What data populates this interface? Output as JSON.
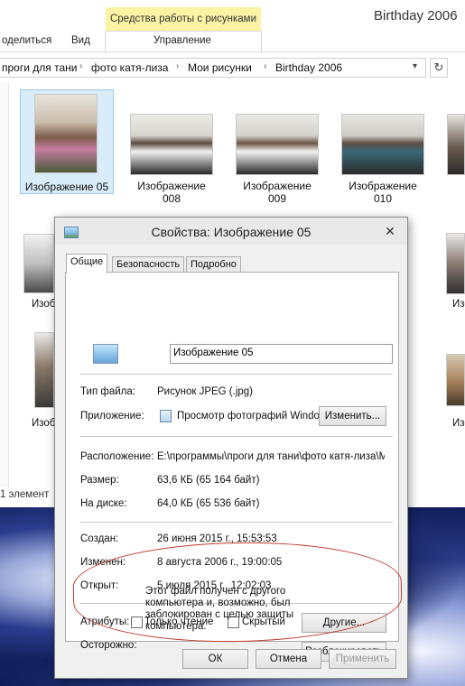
{
  "explorer": {
    "window_title": "Birthday 2006",
    "picture_tools_tab": "Средства работы с рисунками",
    "ribbon_tabs": [
      "оделиться",
      "Вид",
      "Управление"
    ],
    "breadcrumbs": [
      "проги для тани",
      "фото катя-лиза",
      "Мои рисунки",
      "Birthday 2006"
    ],
    "thumbnails": [
      {
        "line1": "Изображение 05",
        "line2": ""
      },
      {
        "line1": "Изображение",
        "line2": "008"
      },
      {
        "line1": "Изображение",
        "line2": "009"
      },
      {
        "line1": "Изображение",
        "line2": "010"
      }
    ],
    "partial_captions": [
      "Изоб",
      "Изоб",
      "Изоб",
      "Изоб"
    ],
    "status": "1 элемент"
  },
  "dialog": {
    "title": "Свойства: Изображение 05",
    "tabs": [
      "Общие",
      "Безопасность",
      "Подробно"
    ],
    "file_name": "Изображение 05",
    "file_type_label": "Тип файла:",
    "file_type_value": "Рисунок JPEG (.jpg)",
    "app_label": "Приложение:",
    "app_value": "Просмотр фотографий Windows",
    "change_button": "Изменить...",
    "location_label": "Расположение:",
    "location_value": "E:\\программы\\проги для тани\\фото катя-лиза\\М",
    "size_label": "Размер:",
    "size_value": "63,6 КБ (65 164 байт)",
    "disk_label": "На диске:",
    "disk_value": "64,0 КБ (65 536 байт)",
    "created_label": "Создан:",
    "created_value": "26 июня 2015 г., 15:53:53",
    "modified_label": "Изменен:",
    "modified_value": "8 августа 2006 г., 19:00:05",
    "opened_label": "Открыт:",
    "opened_value": "5 июля 2015 г., 12:02:03",
    "attributes_label": "Атрибуты:",
    "readonly_label": "Только чтение",
    "hidden_label": "Скрытый",
    "other_button": "Другие...",
    "caution_label": "Осторожно:",
    "caution_text": "Этот файл получен с другого компьютера и, возможно, был заблокирован с целью защиты компьютера.",
    "unblock_button": "Разблокировать",
    "ok_button": "ОК",
    "cancel_button": "Отмена",
    "apply_button": "Применить",
    "close_glyph": "✕"
  }
}
